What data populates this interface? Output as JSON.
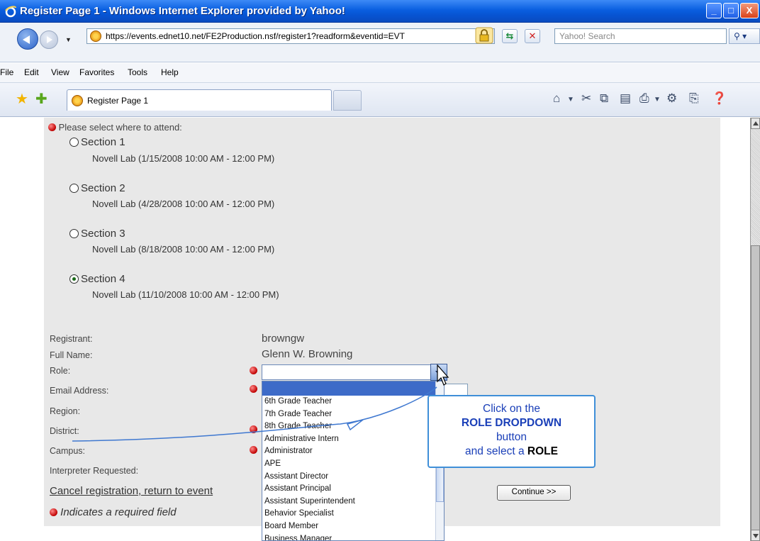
{
  "window": {
    "title": "Register Page 1 - Windows Internet Explorer provided by Yahoo!",
    "controls": [
      "_",
      "□",
      "X"
    ]
  },
  "addressbar": {
    "url": "https://events.ednet10.net/FE2Production.nsf/register1?readform&eventid=EVT",
    "search_placeholder": "Yahoo! Search"
  },
  "menu": [
    "File",
    "Edit",
    "View",
    "Favorites",
    "Tools",
    "Help"
  ],
  "tab": {
    "label": "Register Page 1"
  },
  "form": {
    "attend_prompt": "Please select where to attend:",
    "sections": [
      {
        "label": "Section 1",
        "detail": "Novell Lab (1/15/2008 10:00 AM - 12:00 PM)",
        "selected": false
      },
      {
        "label": "Section 2",
        "detail": "Novell Lab (4/28/2008 10:00 AM - 12:00 PM)",
        "selected": false
      },
      {
        "label": "Section 3",
        "detail": "Novell Lab (8/18/2008 10:00 AM - 12:00 PM)",
        "selected": false
      },
      {
        "label": "Section 4",
        "detail": "Novell Lab (11/10/2008 10:00 AM - 12:00 PM)",
        "selected": true
      }
    ],
    "fields": {
      "registrant_label": "Registrant:",
      "registrant_value": "browngw",
      "fullname_label": "Full Name:",
      "fullname_value": "Glenn W. Browning",
      "role_label": "Role:",
      "email_label": "Email Address:",
      "region_label": "Region:",
      "district_label": "District:",
      "campus_label": "Campus:",
      "interpreter_label": "Interpreter Requested:"
    },
    "role_options": [
      "6th Grade Teacher",
      "7th Grade Teacher",
      "8th Grade Teacher",
      "Administrative Intern",
      "Administrator",
      "APE",
      "Assistant Director",
      "Assistant Principal",
      "Assistant Superintendent",
      "Behavior Specialist",
      "Board Member",
      "Business Manager"
    ],
    "cancel_link": "Cancel registration, return to event",
    "required_legend": "Indicates a required field",
    "continue_label": "Continue >>"
  },
  "callout": {
    "line1": "Click on the",
    "line2": "ROLE DROPDOWN",
    "line3": "button",
    "line4_prefix": "and select a ",
    "line4_bold": "ROLE"
  },
  "colors": {
    "titlebar": "#0a5fe0",
    "panel": "#e8e8e8",
    "callout_border": "#3f8fd8",
    "callout_text": "#1a3fb8",
    "required_dot": "#c00000"
  }
}
